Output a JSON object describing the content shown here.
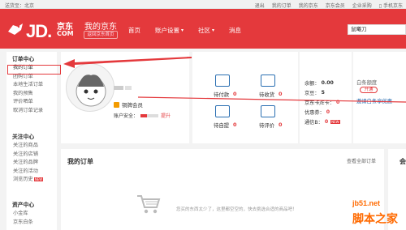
{
  "topbar": {
    "location": "送货至：北京",
    "links": [
      "退出",
      "我的订单",
      "我的京东",
      "京东会员",
      "企业采购",
      "手机京东"
    ]
  },
  "header": {
    "logo_main": "JD.",
    "logo_cn": "京东",
    "logo_com": "COM",
    "title": "我的京东",
    "back_home": "返回京东首页",
    "nav": [
      {
        "label": "首页",
        "caret": false
      },
      {
        "label": "账户设置",
        "caret": true
      },
      {
        "label": "社区",
        "caret": true
      },
      {
        "label": "消息",
        "caret": false
      }
    ],
    "search_value": "鼠曦刀"
  },
  "sidebar": {
    "groups": [
      {
        "title": "订单中心",
        "items": [
          "我的订单",
          "团购订单",
          "本地生活订单",
          "我的预售",
          "评价晒单",
          "取消订单记录"
        ]
      },
      {
        "title": "关注中心",
        "items": [
          "关注的商品",
          "关注的店铺",
          "关注的品牌",
          "关注的活动",
          "浏览历史"
        ]
      },
      {
        "title": "资产中心",
        "items": [
          "小金库",
          "京东白条"
        ]
      }
    ],
    "new_badge": "NEW"
  },
  "profile": {
    "member_label": "铜牌会员",
    "safety_label": "账户安全：",
    "safety_level": 0.35,
    "upgrade": "提升"
  },
  "order_status": [
    {
      "label": "待付款",
      "count": "0",
      "icon": "wallet-icon"
    },
    {
      "label": "待收货",
      "count": "0",
      "icon": "truck-icon"
    },
    {
      "label": "待自提",
      "count": "0",
      "icon": "pickup-icon"
    },
    {
      "label": "待评价",
      "count": "0",
      "icon": "review-icon"
    }
  ],
  "assets": {
    "rows": [
      {
        "label": "余额：",
        "value": "0.00",
        "red": false
      },
      {
        "label": "京豆：",
        "value": "5",
        "red": false
      },
      {
        "label": "京东卡/E卡：",
        "value": "0",
        "red": true
      },
      {
        "label": "优惠券：",
        "value": "0",
        "red": true
      },
      {
        "label": "通信B：",
        "value": "0",
        "red": true
      }
    ],
    "new_badge": "NEW"
  },
  "credit": {
    "title": "白条额度",
    "status": "开通",
    "link": "邀请白条享优惠"
  },
  "orders": {
    "title": "我的订单",
    "view_all": "查看全部订单",
    "empty_text": "您买的东西太少了，这里都空空的，快去挑选合适的商品吧！",
    "right_title": "会"
  },
  "watermark": {
    "site": "jb51.net",
    "cn": "脚本之家"
  },
  "colors": {
    "brand": "#e4393c",
    "link": "#2a6fb2"
  }
}
